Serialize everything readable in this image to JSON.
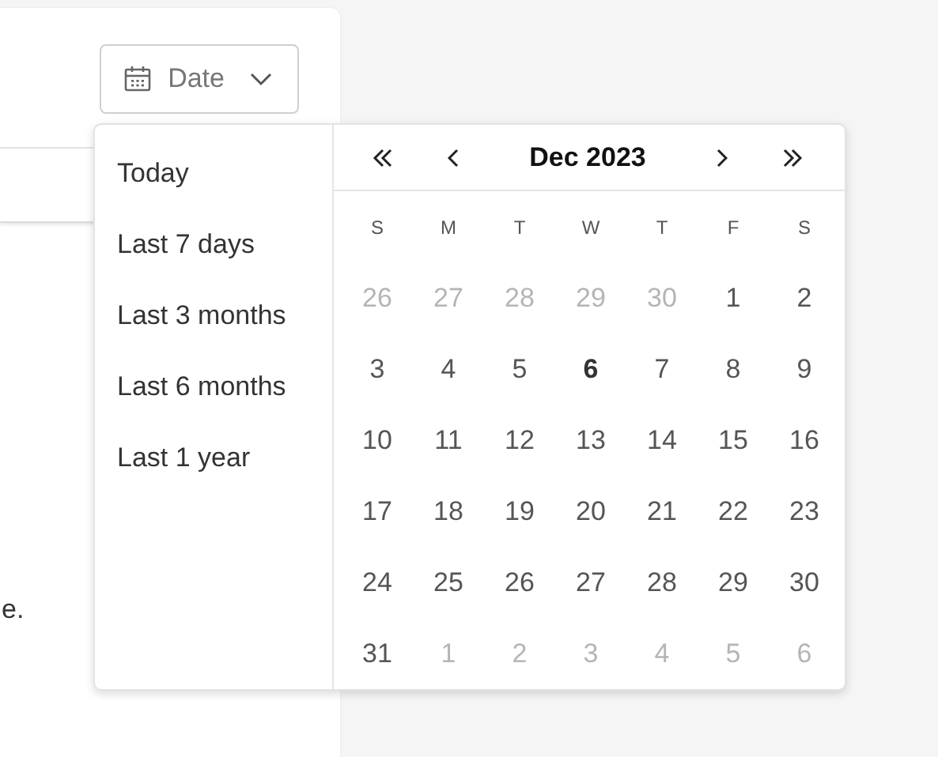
{
  "date_button": {
    "label": "Date"
  },
  "background_text": "e.",
  "presets": [
    {
      "label": "Today"
    },
    {
      "label": "Last 7 days"
    },
    {
      "label": "Last 3 months"
    },
    {
      "label": "Last 6 months"
    },
    {
      "label": "Last 1 year"
    }
  ],
  "calendar": {
    "month_label": "Dec 2023",
    "weekdays": [
      "S",
      "M",
      "T",
      "W",
      "T",
      "F",
      "S"
    ],
    "days": [
      {
        "label": "26",
        "in_month": false,
        "today": false
      },
      {
        "label": "27",
        "in_month": false,
        "today": false
      },
      {
        "label": "28",
        "in_month": false,
        "today": false
      },
      {
        "label": "29",
        "in_month": false,
        "today": false
      },
      {
        "label": "30",
        "in_month": false,
        "today": false
      },
      {
        "label": "1",
        "in_month": true,
        "today": false
      },
      {
        "label": "2",
        "in_month": true,
        "today": false
      },
      {
        "label": "3",
        "in_month": true,
        "today": false
      },
      {
        "label": "4",
        "in_month": true,
        "today": false
      },
      {
        "label": "5",
        "in_month": true,
        "today": false
      },
      {
        "label": "6",
        "in_month": true,
        "today": true
      },
      {
        "label": "7",
        "in_month": true,
        "today": false
      },
      {
        "label": "8",
        "in_month": true,
        "today": false
      },
      {
        "label": "9",
        "in_month": true,
        "today": false
      },
      {
        "label": "10",
        "in_month": true,
        "today": false
      },
      {
        "label": "11",
        "in_month": true,
        "today": false
      },
      {
        "label": "12",
        "in_month": true,
        "today": false
      },
      {
        "label": "13",
        "in_month": true,
        "today": false
      },
      {
        "label": "14",
        "in_month": true,
        "today": false
      },
      {
        "label": "15",
        "in_month": true,
        "today": false
      },
      {
        "label": "16",
        "in_month": true,
        "today": false
      },
      {
        "label": "17",
        "in_month": true,
        "today": false
      },
      {
        "label": "18",
        "in_month": true,
        "today": false
      },
      {
        "label": "19",
        "in_month": true,
        "today": false
      },
      {
        "label": "20",
        "in_month": true,
        "today": false
      },
      {
        "label": "21",
        "in_month": true,
        "today": false
      },
      {
        "label": "22",
        "in_month": true,
        "today": false
      },
      {
        "label": "23",
        "in_month": true,
        "today": false
      },
      {
        "label": "24",
        "in_month": true,
        "today": false
      },
      {
        "label": "25",
        "in_month": true,
        "today": false
      },
      {
        "label": "26",
        "in_month": true,
        "today": false
      },
      {
        "label": "27",
        "in_month": true,
        "today": false
      },
      {
        "label": "28",
        "in_month": true,
        "today": false
      },
      {
        "label": "29",
        "in_month": true,
        "today": false
      },
      {
        "label": "30",
        "in_month": true,
        "today": false
      },
      {
        "label": "31",
        "in_month": true,
        "today": false
      },
      {
        "label": "1",
        "in_month": false,
        "today": false
      },
      {
        "label": "2",
        "in_month": false,
        "today": false
      },
      {
        "label": "3",
        "in_month": false,
        "today": false
      },
      {
        "label": "4",
        "in_month": false,
        "today": false
      },
      {
        "label": "5",
        "in_month": false,
        "today": false
      },
      {
        "label": "6",
        "in_month": false,
        "today": false
      }
    ]
  }
}
